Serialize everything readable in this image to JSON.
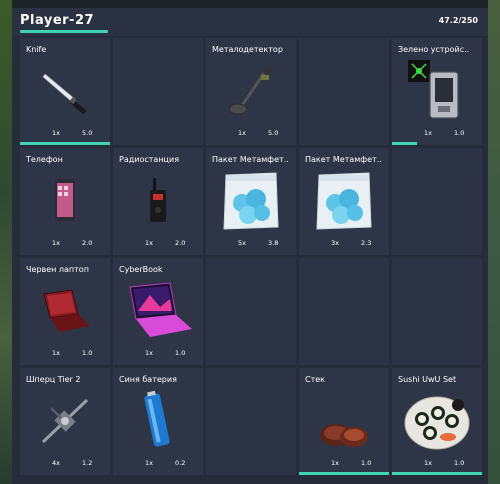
{
  "header": {
    "player_name": "Player-27",
    "weight_label": "47.2/250"
  },
  "accent_color": "#3fd4b4",
  "slots": [
    {
      "name": "Knife",
      "count": "1x",
      "weight": "5.0",
      "icon": "knife-icon",
      "durability": 1.0
    },
    {
      "name": "",
      "empty": true
    },
    {
      "name": "Металодетектор",
      "count": "1x",
      "weight": "5.0",
      "icon": "metal-detector-icon"
    },
    {
      "name": "",
      "empty": true
    },
    {
      "name": "Зелено устройс..",
      "count": "1x",
      "weight": "1.0",
      "icon": "green-device-icon",
      "durability": 0.28
    },
    {
      "name": "Телефон",
      "count": "1x",
      "weight": "2.0",
      "icon": "phone-icon"
    },
    {
      "name": "Радиостанция",
      "count": "1x",
      "weight": "2.0",
      "icon": "radio-icon"
    },
    {
      "name": "Пакет Метамфет..",
      "count": "5x",
      "weight": "3.8",
      "icon": "meth-bag-icon"
    },
    {
      "name": "Пакет Метамфет..",
      "count": "3x",
      "weight": "2.3",
      "icon": "meth-bag-icon"
    },
    {
      "name": "",
      "empty": true
    },
    {
      "name": "Червен лаптоп",
      "count": "1x",
      "weight": "1.0",
      "icon": "red-laptop-icon"
    },
    {
      "name": "CyberBook",
      "count": "1x",
      "weight": "1.0",
      "icon": "cyberbook-laptop-icon"
    },
    {
      "name": "",
      "empty": true
    },
    {
      "name": "",
      "empty": true
    },
    {
      "name": "",
      "empty": true
    },
    {
      "name": "Шперц Tier 2",
      "count": "4x",
      "weight": "1.2",
      "icon": "lockpick-icon"
    },
    {
      "name": "Синя батерия",
      "count": "1x",
      "weight": "0.2",
      "icon": "blue-battery-icon"
    },
    {
      "name": "",
      "empty": true
    },
    {
      "name": "Стек",
      "count": "1x",
      "weight": "1.0",
      "icon": "steak-icon",
      "durability": 1.0
    },
    {
      "name": "Sushi UwU Set",
      "count": "1x",
      "weight": "1.0",
      "icon": "sushi-icon",
      "durability": 1.0
    }
  ]
}
